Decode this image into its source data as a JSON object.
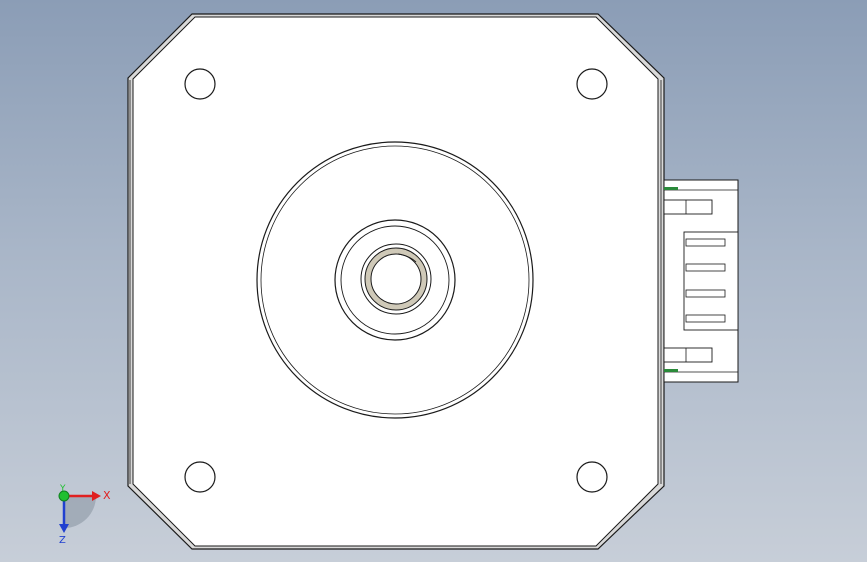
{
  "triad": {
    "x_label": "X",
    "y_label": "Y",
    "z_label": "Z",
    "x_color": "#e02020",
    "y_color": "#20c030",
    "z_color": "#2040d0"
  },
  "colors": {
    "part_face": "#ffffff",
    "part_edge": "#1a1a1a",
    "part_side": "#d9d9d9",
    "bore_ring": "#cfc9b8",
    "connector_accent": "#2a8a3a"
  }
}
